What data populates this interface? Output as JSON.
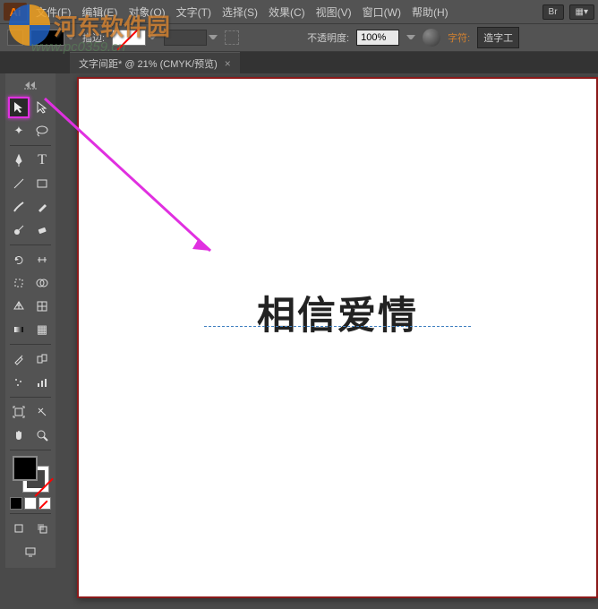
{
  "app": {
    "logo": "Ai"
  },
  "menu": {
    "file": "文件(F)",
    "edit": "编辑(E)",
    "object": "对象(O)",
    "type": "文字(T)",
    "select": "选择(S)",
    "effect": "效果(C)",
    "view": "视图(V)",
    "window": "窗口(W)",
    "help": "帮助(H)",
    "br": "Br",
    "layout": "▦▾"
  },
  "options": {
    "stroke_label": "描边:",
    "opacity_label": "不透明度:",
    "opacity_value": "100%",
    "char_label": "字符:",
    "char_button": "造字工"
  },
  "tab": {
    "title": "文字间距* @ 21% (CMYK/预览)",
    "close": "×"
  },
  "canvas": {
    "text": "相信爱情"
  },
  "tool_names": {
    "selection": "选择工具",
    "direct": "直接选择工具"
  },
  "watermark": {
    "text": "河东软件园",
    "url": "www.pc0359.cn"
  }
}
